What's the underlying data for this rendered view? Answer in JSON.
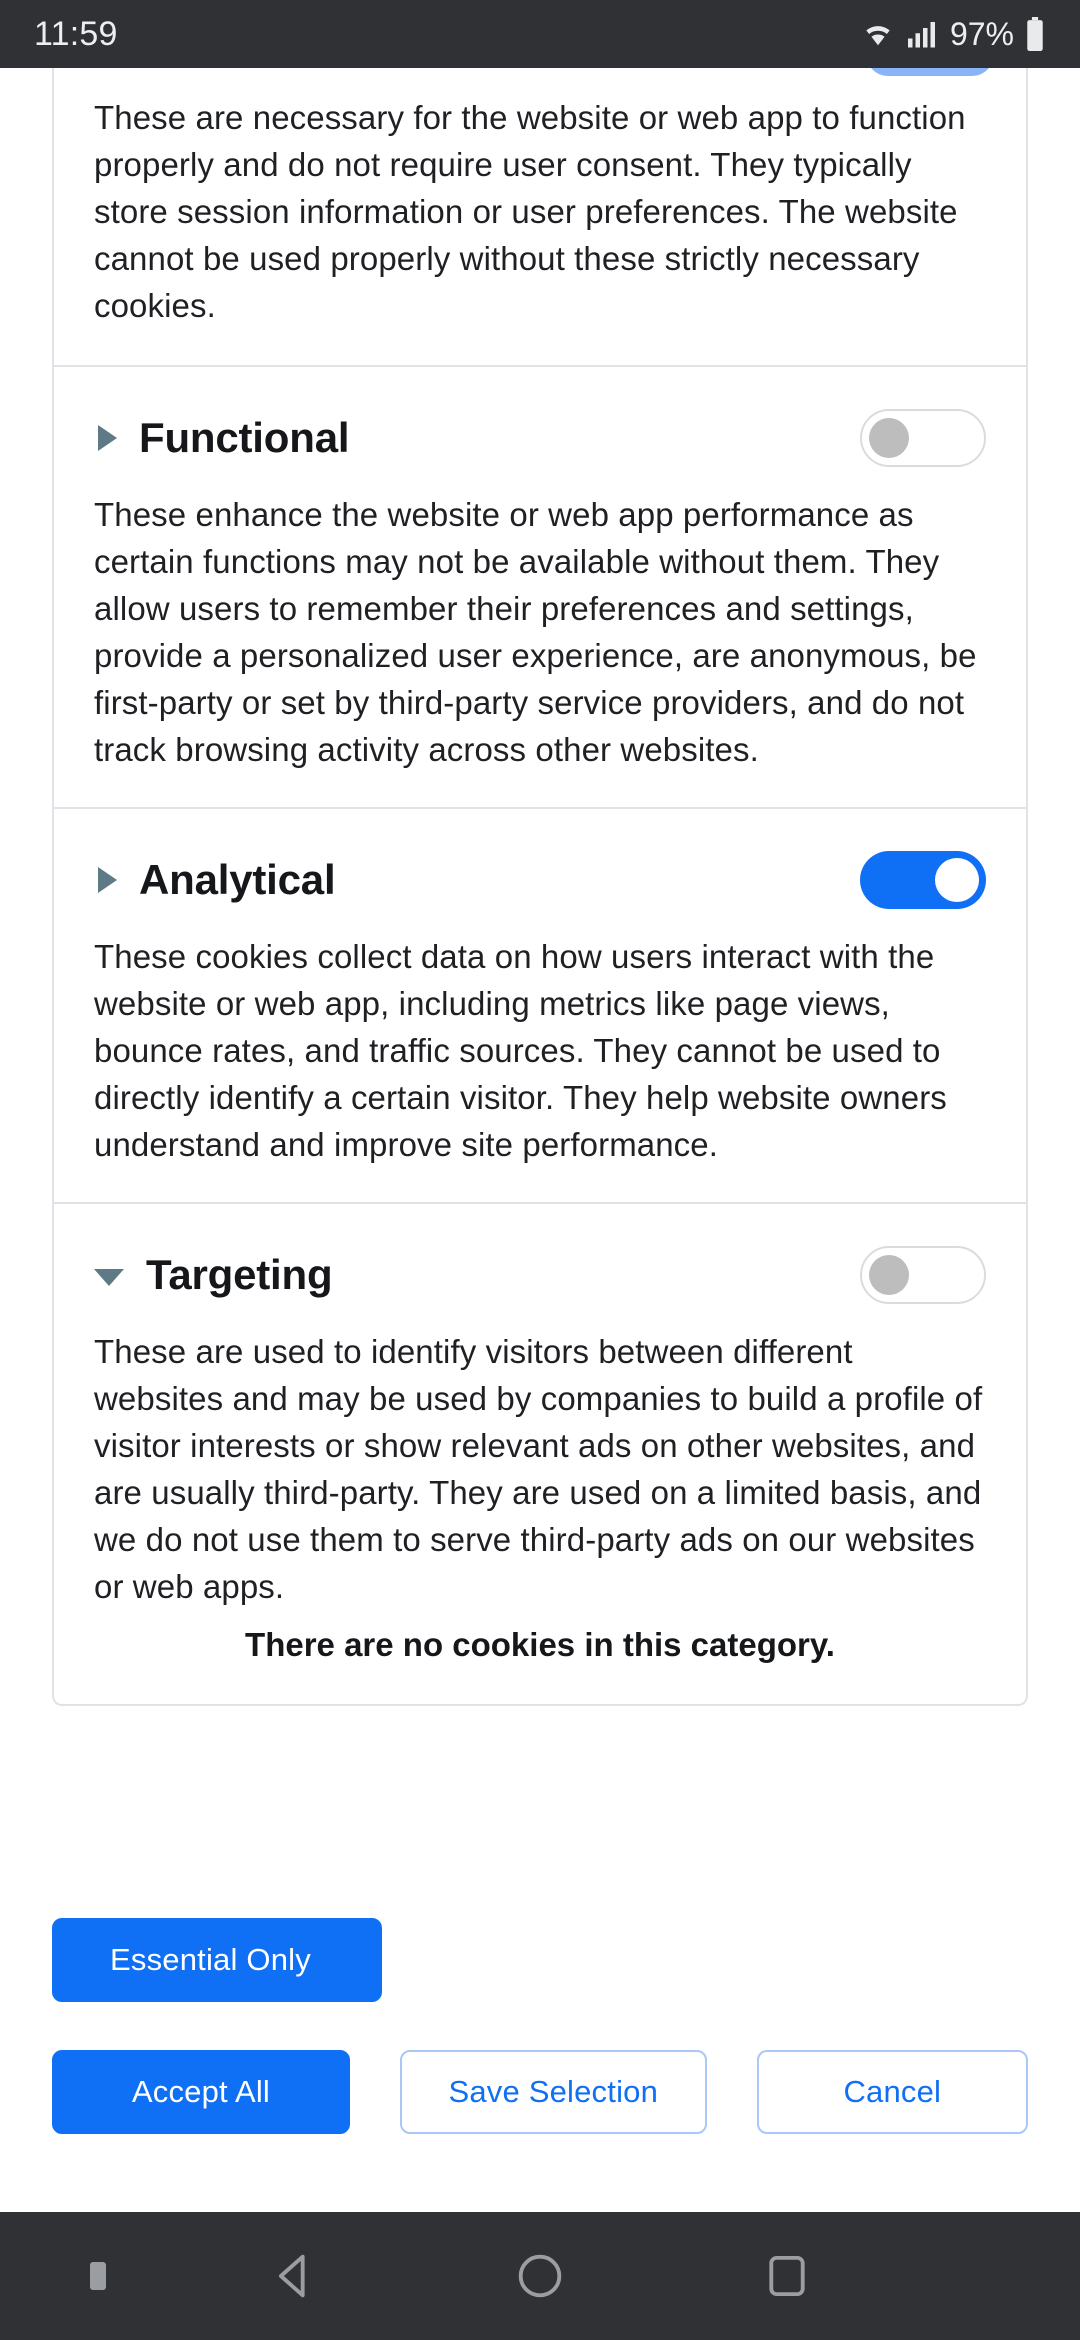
{
  "status_bar": {
    "time": "11:59",
    "battery_percent": "97%",
    "icons": [
      "wifi-icon",
      "cellular-signal-icon",
      "battery-icon"
    ]
  },
  "dialog": {
    "sections": [
      {
        "id": "strictly-necessary",
        "title": "",
        "expanded": true,
        "toggle_state": "on-partial",
        "description": "These are necessary for the website or web app to function properly and do not require user consent. They typically store session information or user preferences. The website cannot be used properly without these strictly necessary cookies."
      },
      {
        "id": "functional",
        "title": "Functional",
        "marker": "triangle-right-icon",
        "expanded": false,
        "toggle_state": "off",
        "description": "These enhance the website or web app performance as certain functions may not be available without them. They allow users to remember their preferences and settings, provide a personalized user experience, are anonymous, be first-party or set by third-party service providers, and do not track browsing activity across other websites."
      },
      {
        "id": "analytical",
        "title": "Analytical",
        "marker": "triangle-right-icon",
        "expanded": false,
        "toggle_state": "on",
        "description": "These cookies collect data on how users interact with the website or web app, including metrics like page views, bounce rates, and traffic sources. They cannot be used to directly identify a certain visitor. They help website owners understand and improve site performance."
      },
      {
        "id": "targeting",
        "title": "Targeting",
        "marker": "triangle-down-icon",
        "expanded": true,
        "toggle_state": "off",
        "description": "These are used to identify visitors between different websites and may be used by companies to build a profile of visitor interests or show relevant ads on other websites, and are usually third-party. They are used on a limited basis, and we do not use them to serve third-party ads on our websites or web apps.",
        "empty_message": "There are no cookies in this category."
      }
    ]
  },
  "actions": {
    "essential_only": "Essential Only",
    "accept_all": "Accept All",
    "save_selection": "Save Selection",
    "cancel": "Cancel"
  },
  "colors": {
    "accent_blue": "#1070f5",
    "toggle_off_knob": "#bdbdbd",
    "marker_slate": "#5f7a87",
    "border": "#dfe3e8",
    "status_bar_bg": "#303135"
  },
  "nav_bar": {
    "items": [
      "back-icon",
      "home-icon",
      "recents-icon"
    ]
  }
}
